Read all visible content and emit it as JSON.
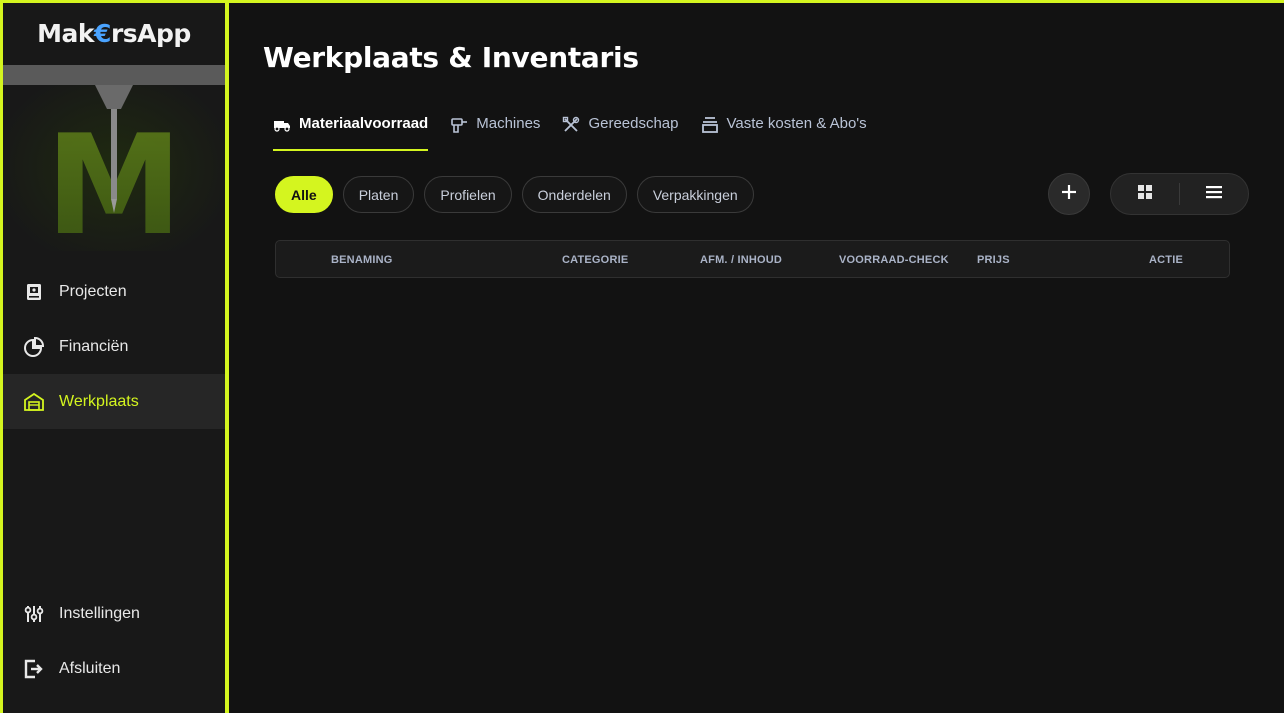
{
  "brand": {
    "prefix": "Mak",
    "euro": "€",
    "suffix": "rsApp"
  },
  "sidebar": {
    "items": [
      {
        "label": "Projecten",
        "icon": "clipboard-icon",
        "active": false
      },
      {
        "label": "Financiën",
        "icon": "pie-chart-icon",
        "active": false
      },
      {
        "label": "Werkplaats",
        "icon": "garage-icon",
        "active": true
      }
    ],
    "bottom_items": [
      {
        "label": "Instellingen",
        "icon": "sliders-icon"
      },
      {
        "label": "Afsluiten",
        "icon": "logout-icon"
      }
    ]
  },
  "page": {
    "title": "Werkplaats & Inventaris"
  },
  "tabs": [
    {
      "label": "Materiaalvoorraad",
      "icon": "truck-icon",
      "active": true
    },
    {
      "label": "Machines",
      "icon": "drill-icon",
      "active": false
    },
    {
      "label": "Gereedschap",
      "icon": "tools-icon",
      "active": false
    },
    {
      "label": "Vaste kosten & Abo's",
      "icon": "archive-icon",
      "active": false
    }
  ],
  "filters": [
    {
      "label": "Alle",
      "active": true
    },
    {
      "label": "Platen",
      "active": false
    },
    {
      "label": "Profielen",
      "active": false
    },
    {
      "label": "Onderdelen",
      "active": false
    },
    {
      "label": "Verpakkingen",
      "active": false
    }
  ],
  "table": {
    "columns": [
      "BENAMING",
      "CATEGORIE",
      "AFM. / INHOUD",
      "VOORRAAD-CHECK",
      "PRIJS",
      "ACTIE"
    ]
  },
  "colors": {
    "accent": "#d4f51f",
    "background": "#121212",
    "sidebar": "#181818"
  }
}
